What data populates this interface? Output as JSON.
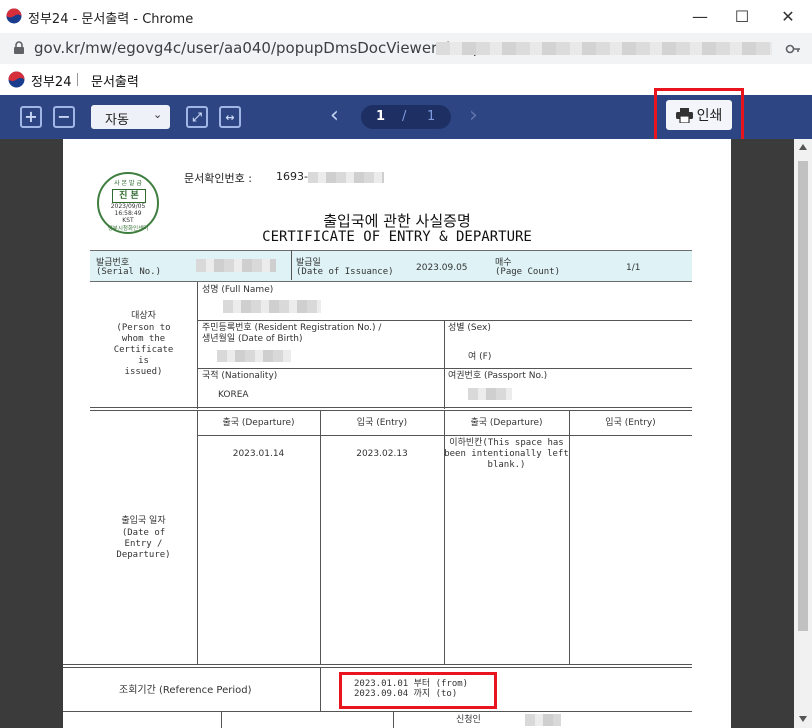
{
  "window": {
    "title": "정부24 - 문서출력 - Chrome",
    "min_glyph": "—",
    "max_glyph": "☐",
    "close_glyph": "✕"
  },
  "address": {
    "url": "gov.kr/mw/egovg4c/user/aa040/popupDmsDocViewer.do?q="
  },
  "site": {
    "name": "정부24",
    "page": "문서출력"
  },
  "toolbar": {
    "zoom_in": "+",
    "zoom_out": "−",
    "zoom_value": "자동",
    "zoom_chevron": "⌄",
    "fit_page": "⤢",
    "fit_width": "↔",
    "prev": "‹",
    "next": "›",
    "page_current": "1",
    "page_sep": "/",
    "page_total": "1",
    "print_label": "인쇄"
  },
  "document": {
    "doc_number_label": "문서확인번호 :",
    "doc_number_visible": "1693-",
    "seal": {
      "top": "사 본 발 급",
      "main": "진 본",
      "date": "2023/09/05",
      "time": "16:58:49",
      "tz": "KST",
      "org": "정부시청화인센터"
    },
    "title_ko": "출입국에 관한 사실증명",
    "title_en": "CERTIFICATE OF ENTRY & DEPARTURE",
    "header": {
      "serial_ko": "발급번호",
      "serial_en": "(Serial No.)",
      "issue_ko": "발급일",
      "issue_en": "(Date of Issuance)",
      "issue_val": "2023.09.05",
      "pages_ko": "매수",
      "pages_en": "(Page Count)",
      "pages_val": "1/1"
    },
    "subject": {
      "label_ko": "대상자",
      "label_en": "(Person to\nwhom the\nCertificate\nis\nissued)",
      "name_label": "성명 (Full Name)",
      "rrn_label": "주민등록번호 (Resident Registration No.) /\n생년월일 (Date of Birth)",
      "sex_label": "성별 (Sex)",
      "sex_val": "여 (F)",
      "nationality_label": "국적 (Nationality)",
      "nationality_val": "KOREA",
      "passport_label": "여권번호 (Passport No.)"
    },
    "entry": {
      "label_ko": "출입국 일자",
      "label_en": "(Date of\nEntry /\nDeparture)",
      "headers": [
        "출국 (Departure)",
        "입국 (Entry)",
        "출국 (Departure)",
        "입국 (Entry)"
      ],
      "dep1": "2023.01.14",
      "ent1": "2023.02.13",
      "note": "이하빈칸(This space has\nbeen intentionally left\nblank.)"
    },
    "period": {
      "label": "조회기간 (Reference Period)",
      "from": "2023.01.01 부터 (from)",
      "to": "2023.09.04 까지 (to)"
    },
    "applicant_label": "신청인"
  },
  "colors": {
    "toolbar": "#2d4683",
    "highlight": "#e8151e",
    "header_row": "#dff3f6"
  }
}
